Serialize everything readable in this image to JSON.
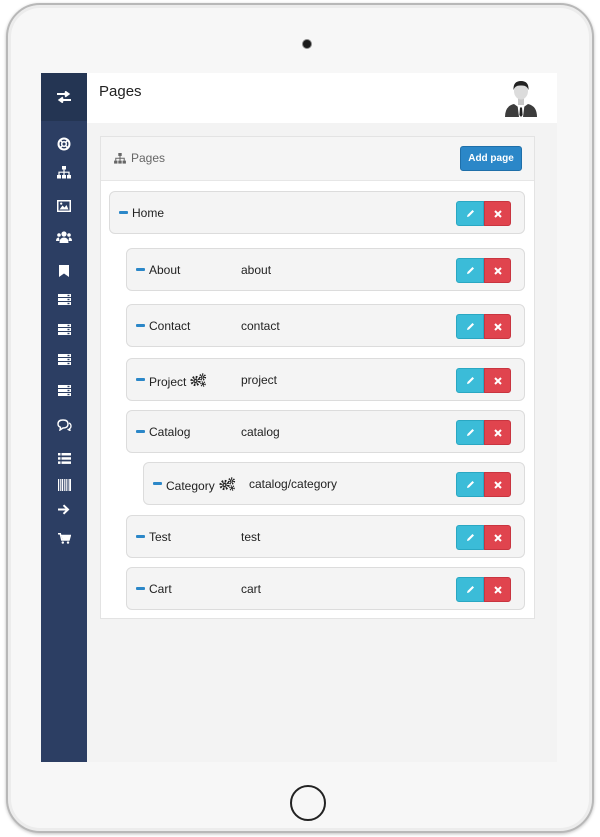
{
  "header": {
    "title": "Pages",
    "avatar_icon": "user-avatar"
  },
  "sidebar": {
    "toggle_icon": "exchange-icon",
    "items": [
      {
        "icon": "lifebuoy-icon"
      },
      {
        "icon": "sitemap-icon"
      },
      {
        "icon": "image-icon"
      },
      {
        "icon": "users-icon"
      },
      {
        "icon": "bookmark-icon"
      },
      {
        "icon": "server-icon"
      },
      {
        "icon": "server-icon"
      },
      {
        "icon": "server-icon"
      },
      {
        "icon": "server-icon"
      },
      {
        "icon": "comments-icon"
      },
      {
        "icon": "list-icon"
      },
      {
        "icon": "barcode-icon"
      },
      {
        "icon": "arrow-right-icon"
      },
      {
        "icon": "cart-icon"
      }
    ]
  },
  "panel": {
    "title": "Pages",
    "title_icon": "sitemap-icon",
    "add_button_label": "Add page"
  },
  "pages": [
    {
      "name": "Home",
      "slug": "",
      "has_gears": false,
      "level": 0
    },
    {
      "name": "About",
      "slug": "about",
      "has_gears": false,
      "level": 1
    },
    {
      "name": "Contact",
      "slug": "contact",
      "has_gears": false,
      "level": 1
    },
    {
      "name": "Project",
      "slug": "project",
      "has_gears": true,
      "level": 1
    },
    {
      "name": "Catalog",
      "slug": "catalog",
      "has_gears": false,
      "level": 1
    },
    {
      "name": "Category",
      "slug": "catalog/category",
      "has_gears": true,
      "level": 2
    },
    {
      "name": "Test",
      "slug": "test",
      "has_gears": false,
      "level": 1
    },
    {
      "name": "Cart",
      "slug": "cart",
      "has_gears": false,
      "level": 1
    }
  ],
  "colors": {
    "sidebar": "#2c3e63",
    "primary": "#2b87c8",
    "edit": "#3bbcd8",
    "delete": "#e0444e"
  }
}
